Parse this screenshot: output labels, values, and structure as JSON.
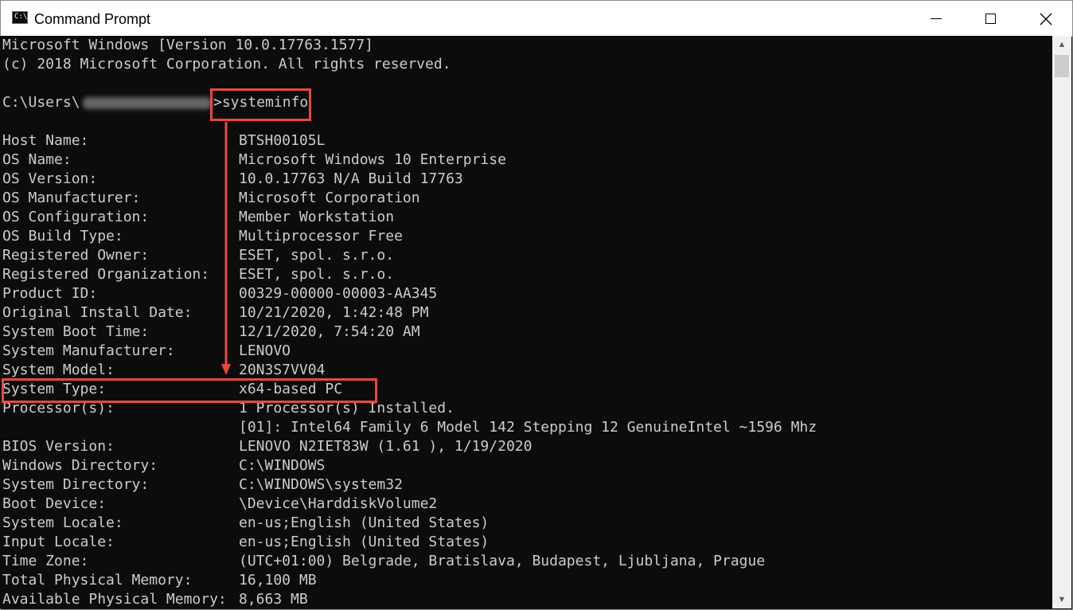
{
  "window": {
    "title": "Command Prompt",
    "icon": "cmd-app-icon",
    "icon_text": "C:\\_"
  },
  "console": {
    "header": [
      "Microsoft Windows [Version 10.0.17763.1577]",
      "(c) 2018 Microsoft Corporation. All rights reserved."
    ],
    "prompt_prefix": "C:\\Users\\",
    "prompt_suffix": ">",
    "command": "systeminfo",
    "rows": [
      {
        "label": "Host Name:",
        "value": "BTSH00105L"
      },
      {
        "label": "OS Name:",
        "value": "Microsoft Windows 10 Enterprise"
      },
      {
        "label": "OS Version:",
        "value": "10.0.17763 N/A Build 17763"
      },
      {
        "label": "OS Manufacturer:",
        "value": "Microsoft Corporation"
      },
      {
        "label": "OS Configuration:",
        "value": "Member Workstation"
      },
      {
        "label": "OS Build Type:",
        "value": "Multiprocessor Free"
      },
      {
        "label": "Registered Owner:",
        "value": "ESET, spol. s.r.o."
      },
      {
        "label": "Registered Organization:",
        "value": "ESET, spol. s.r.o."
      },
      {
        "label": "Product ID:",
        "value": "00329-00000-00003-AA345"
      },
      {
        "label": "Original Install Date:",
        "value": "10/21/2020, 1:42:48 PM"
      },
      {
        "label": "System Boot Time:",
        "value": "12/1/2020, 7:54:20 AM"
      },
      {
        "label": "System Manufacturer:",
        "value": "LENOVO"
      },
      {
        "label": "System Model:",
        "value": "20N3S7VV04"
      },
      {
        "label": "System Type:",
        "value": "x64-based PC"
      },
      {
        "label": "Processor(s):",
        "value": "1 Processor(s) Installed."
      },
      {
        "label": "",
        "value": "[01]: Intel64 Family 6 Model 142 Stepping 12 GenuineIntel ~1596 Mhz"
      },
      {
        "label": "BIOS Version:",
        "value": "LENOVO N2IET83W (1.61 ), 1/19/2020"
      },
      {
        "label": "Windows Directory:",
        "value": "C:\\WINDOWS"
      },
      {
        "label": "System Directory:",
        "value": "C:\\WINDOWS\\system32"
      },
      {
        "label": "Boot Device:",
        "value": "\\Device\\HarddiskVolume2"
      },
      {
        "label": "System Locale:",
        "value": "en-us;English (United States)"
      },
      {
        "label": "Input Locale:",
        "value": "en-us;English (United States)"
      },
      {
        "label": "Time Zone:",
        "value": "(UTC+01:00) Belgrade, Bratislava, Budapest, Ljubljana, Prague"
      },
      {
        "label": "Total Physical Memory:",
        "value": "16,100 MB"
      },
      {
        "label": "Available Physical Memory:",
        "value": "8,663 MB"
      }
    ]
  },
  "annotations": {
    "highlight_color": "#e8483f"
  },
  "colors": {
    "console_bg": "#0c0c0c",
    "console_fg": "#cccccc",
    "titlebar_bg": "#ffffff"
  }
}
